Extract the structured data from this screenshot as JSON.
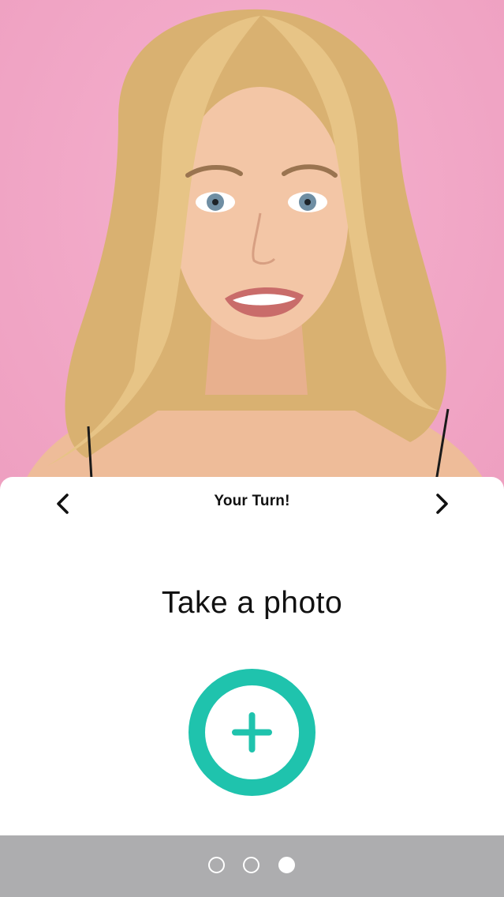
{
  "card": {
    "title": "Your Turn!",
    "heading": "Take a photo"
  },
  "icons": {
    "prev": "chevron-left-icon",
    "next": "chevron-right-icon",
    "add": "plus-icon"
  },
  "colors": {
    "accent": "#1fc3ad",
    "background_pink": "#f2a9c8",
    "pager_bar": "#adadaf"
  },
  "pager": {
    "total_pages": 3,
    "active_page": 3
  }
}
